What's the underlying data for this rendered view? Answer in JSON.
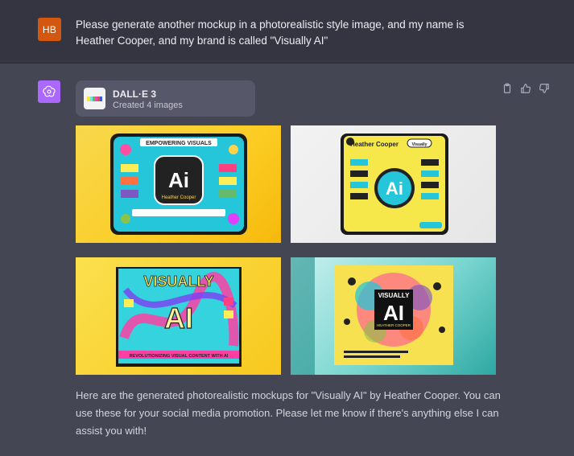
{
  "user_message": {
    "initials": "HB",
    "text": "Please generate another mockup in a photorealistic style image, and my name is Heather Cooper, and my brand is called \"Visually AI\""
  },
  "assistant": {
    "tool": {
      "title": "DALL·E 3",
      "subtitle": "Created 4 images"
    },
    "images": [
      {
        "name": "mockup-1",
        "heading": "EMPOWERING VISUALS",
        "center": "Ai",
        "subname": "Heather Cooper"
      },
      {
        "name": "mockup-2",
        "heading": "Heather Cooper",
        "center": "Ai",
        "button": "Visually"
      },
      {
        "name": "mockup-3",
        "heading": "VISUALLY",
        "center": "AI",
        "footer": "REVOLUTIONIZING VISUAL CONTENT WITH AI"
      },
      {
        "name": "mockup-4",
        "heading": "VISUALLY",
        "center": "AI",
        "subname": "HEATHER COOPER"
      }
    ],
    "reply": "Here are the generated photorealistic mockups for \"Visually AI\" by Heather Cooper. You can use these for your social media promotion. Please let me know if there's anything else I can assist you with!"
  },
  "icons": {
    "copy": "clipboard-icon",
    "like": "thumbs-up-icon",
    "dislike": "thumbs-down-icon",
    "assistant": "openai-logo-icon"
  },
  "colors": {
    "user_avatar": "#d4570f",
    "assistant_avatar": "#ab68ff",
    "page_bg": "#444654",
    "user_row_bg": "#343541"
  }
}
